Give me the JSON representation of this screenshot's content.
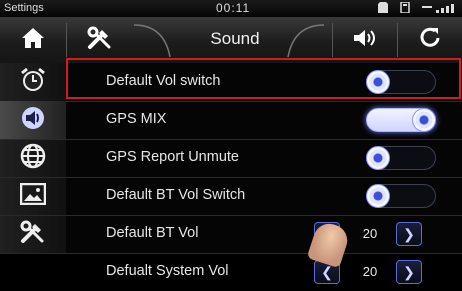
{
  "status_bar": {
    "title": "Settings",
    "time": "00:11"
  },
  "top_nav": {
    "title": "Sound",
    "icons": [
      "home-icon",
      "tools-icon",
      "speaker-icon",
      "refresh-icon"
    ]
  },
  "sidebar": {
    "items": [
      {
        "icon": "alarm-clock-icon",
        "active": false
      },
      {
        "icon": "speaker-icon",
        "active": true
      },
      {
        "icon": "globe-icon",
        "active": false
      },
      {
        "icon": "picture-icon",
        "active": false
      },
      {
        "icon": "tools-icon",
        "active": false
      }
    ]
  },
  "settings": {
    "rows": [
      {
        "label": "Default Vol switch",
        "type": "toggle",
        "on": false
      },
      {
        "label": "GPS MIX",
        "type": "toggle",
        "on": true
      },
      {
        "label": "GPS Report Unmute",
        "type": "toggle",
        "on": false
      },
      {
        "label": "Default BT Vol Switch",
        "type": "toggle",
        "on": false
      },
      {
        "label": "Default BT Vol",
        "type": "stepper",
        "value": "20"
      },
      {
        "label": "Defualt System Vol",
        "type": "stepper",
        "value": "20"
      }
    ]
  },
  "colors": {
    "accent": "#4a5cff",
    "highlight_box": "#d11c1c"
  }
}
